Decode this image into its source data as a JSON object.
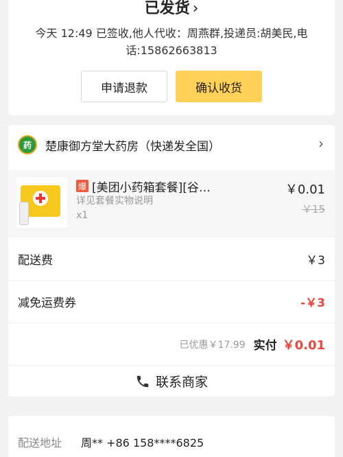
{
  "status": {
    "title": "已发货",
    "description": "今天 12:49 已签收,他人代收：周燕群,投递员:胡美民,电话:15862663813",
    "refund_button": "申请退款",
    "confirm_button": "确认收货"
  },
  "store": {
    "name": "楚康御方堂大药房（快递发全国）"
  },
  "item": {
    "badge": "爆",
    "name": "[美团小药箱套餐][谷…",
    "note": "详见套餐实物说明",
    "quantity": "x1",
    "price": "￥0.01",
    "original_price": "￥15"
  },
  "fees": {
    "delivery_label": "配送费",
    "delivery_value": "￥3",
    "coupon_label": "减免运费券",
    "coupon_value": "-￥3",
    "saved_text": "已优惠￥17.99",
    "paid_label": "实付",
    "paid_value": "￥0.01"
  },
  "contact": {
    "label": "联系商家"
  },
  "address": {
    "label": "配送地址",
    "value": "周**  +86 158****6825"
  },
  "colors": {
    "accent_yellow": "#ffd257",
    "price_red": "#e8453c"
  }
}
